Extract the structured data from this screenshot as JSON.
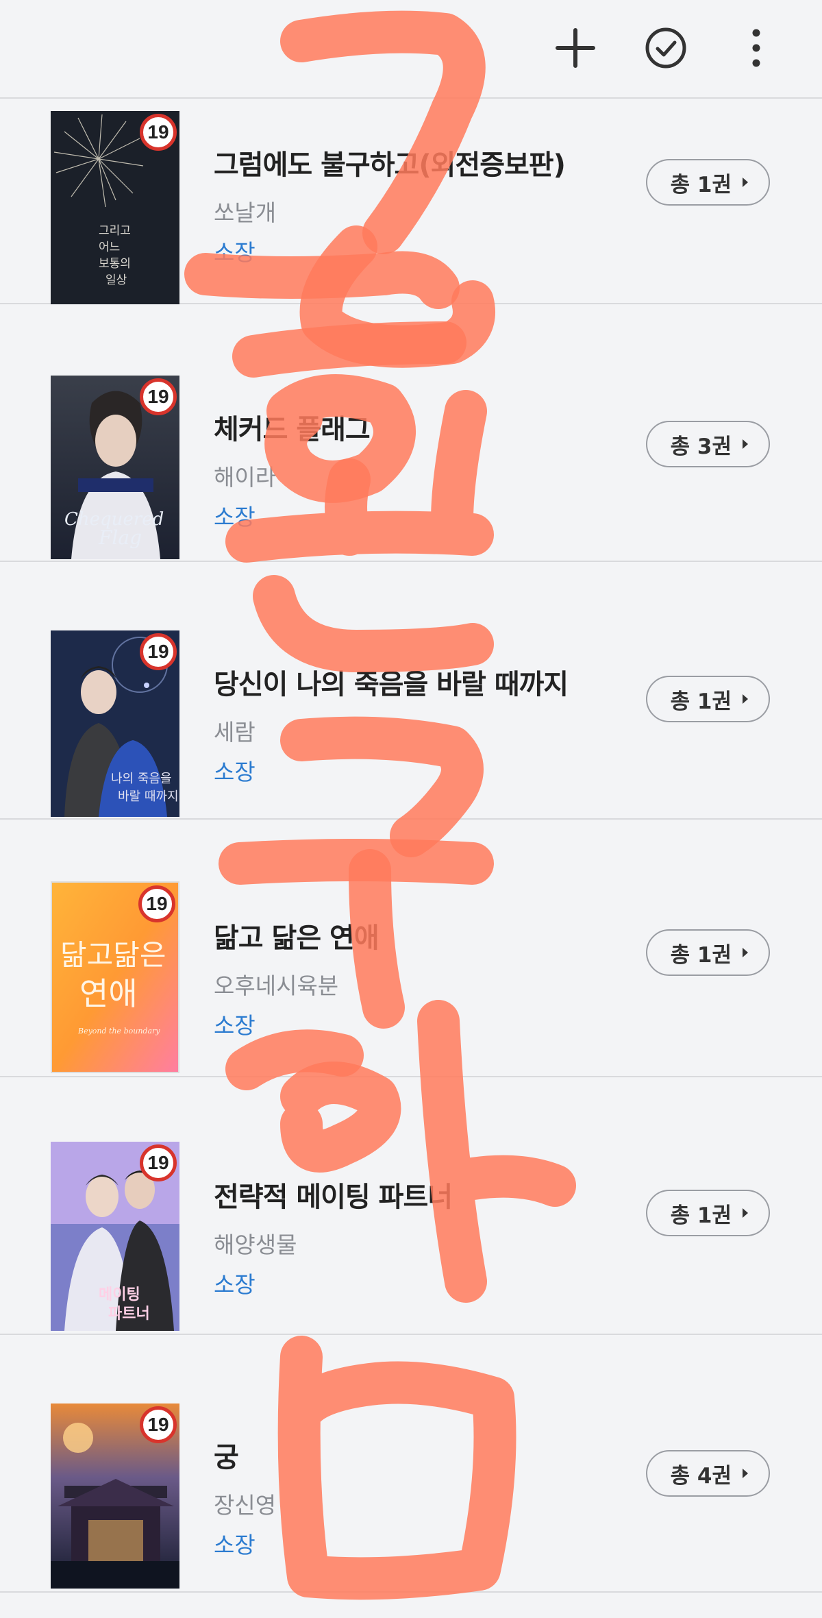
{
  "colors": {
    "background": "#f3f4f6",
    "divider": "#d9dadd",
    "status_blue": "#2b7bd0",
    "badge_red": "#d8342c",
    "watermark": "#ff7a5c"
  },
  "toolbar": {
    "icons": [
      "plus-icon",
      "check-circle-icon",
      "more-vertical-icon"
    ]
  },
  "books": [
    {
      "title": "그럼에도 불구하고(외전증보판)",
      "author": "쏘날개",
      "status": "소장",
      "age": "19",
      "count": "총 1권"
    },
    {
      "title": "체커드 플래그",
      "author": "해이라",
      "status": "소장",
      "age": "19",
      "count": "총 3권"
    },
    {
      "title": "당신이 나의 죽음을 바랄 때까지",
      "author": "세람",
      "status": "소장",
      "age": "19",
      "count": "총 1권"
    },
    {
      "title": "닮고 닮은 연애",
      "author": "오후네시육분",
      "status": "소장",
      "age": "19",
      "count": "총 1권"
    },
    {
      "title": "전략적 메이팅 파트너",
      "author": "해양생물",
      "status": "소장",
      "age": "19",
      "count": "총 1권"
    },
    {
      "title": "궁",
      "author": "장신영",
      "status": "소장",
      "age": "19",
      "count": "총 4권"
    }
  ],
  "watermark_text": "공환구함"
}
